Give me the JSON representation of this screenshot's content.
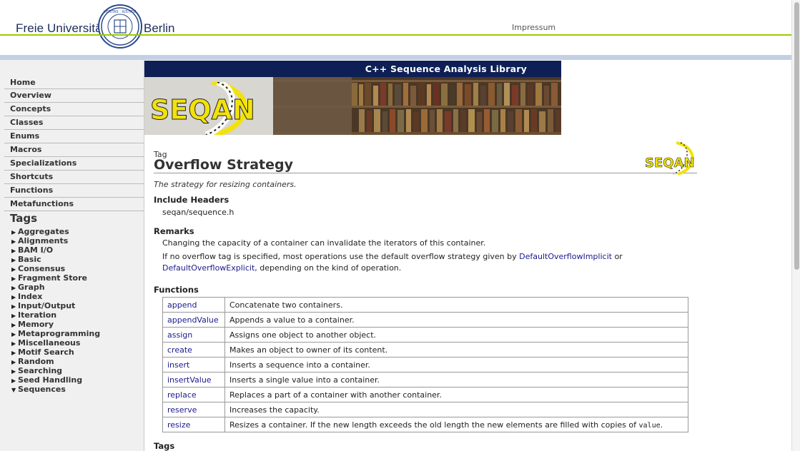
{
  "header": {
    "university_left": "Freie Universität",
    "university_right": "Berlin",
    "impressum": "Impressum"
  },
  "banner": {
    "title": "C++ Sequence Analysis Library",
    "logo_text": "SEQAN"
  },
  "nav": [
    "Home",
    "Overview",
    "Concepts",
    "Classes",
    "Enums",
    "Macros",
    "Specializations",
    "Shortcuts",
    "Functions",
    "Metafunctions"
  ],
  "tags": {
    "heading": "Tags",
    "items": [
      "Aggregates",
      "Alignments",
      "BAM I/O",
      "Basic",
      "Consensus",
      "Fragment Store",
      "Graph",
      "Index",
      "Input/Output",
      "Iteration",
      "Memory",
      "Metaprogramming",
      "Miscellaneous",
      "Motif Search",
      "Random",
      "Searching",
      "Seed Handling",
      "Sequences"
    ],
    "expanded_item": "Sequences"
  },
  "content": {
    "kind": "Tag",
    "title": "Overflow Strategy",
    "small_logo_text": "SEQAN",
    "tagline": "The strategy for resizing containers.",
    "include_heading": "Include Headers",
    "include_file": "seqan/sequence.h",
    "remarks_heading": "Remarks",
    "remark_1": "Changing the capacity of a container can invalidate the iterators of this container.",
    "remark_2_pre": "If no overflow tag is specified, most operations use the default overflow strategy given by",
    "remark_2_link1": "DefaultOverflowImplicit",
    "remark_2_or": "or",
    "remark_2_link2": "DefaultOverflowExplicit",
    "remark_2_post": ", depending on the kind of operation.",
    "functions_heading": "Functions",
    "functions": [
      {
        "name": "append",
        "desc": "Concatenate two containers."
      },
      {
        "name": "appendValue",
        "desc": "Appends a value to a container."
      },
      {
        "name": "assign",
        "desc": "Assigns one object to another object."
      },
      {
        "name": "create",
        "desc": "Makes an object to owner of its content."
      },
      {
        "name": "insert",
        "desc": "Inserts a sequence into a container."
      },
      {
        "name": "insertValue",
        "desc": "Inserts a single value into a container."
      },
      {
        "name": "replace",
        "desc": "Replaces a part of a container with another container."
      },
      {
        "name": "reserve",
        "desc": "Increases the capacity."
      },
      {
        "name": "resize",
        "desc": "Resizes a container. If the new length exceeds the old length the new elements are filled with copies of",
        "code": "value",
        "desc_end": "."
      }
    ],
    "tags_heading": "Tags"
  },
  "colors": {
    "link": "#1a1a8c",
    "banner_bar": "#0e1f55",
    "green_rule": "#99cc00",
    "blue_band": "#c3d0e4",
    "logo_yellow": "#f2e20a"
  }
}
